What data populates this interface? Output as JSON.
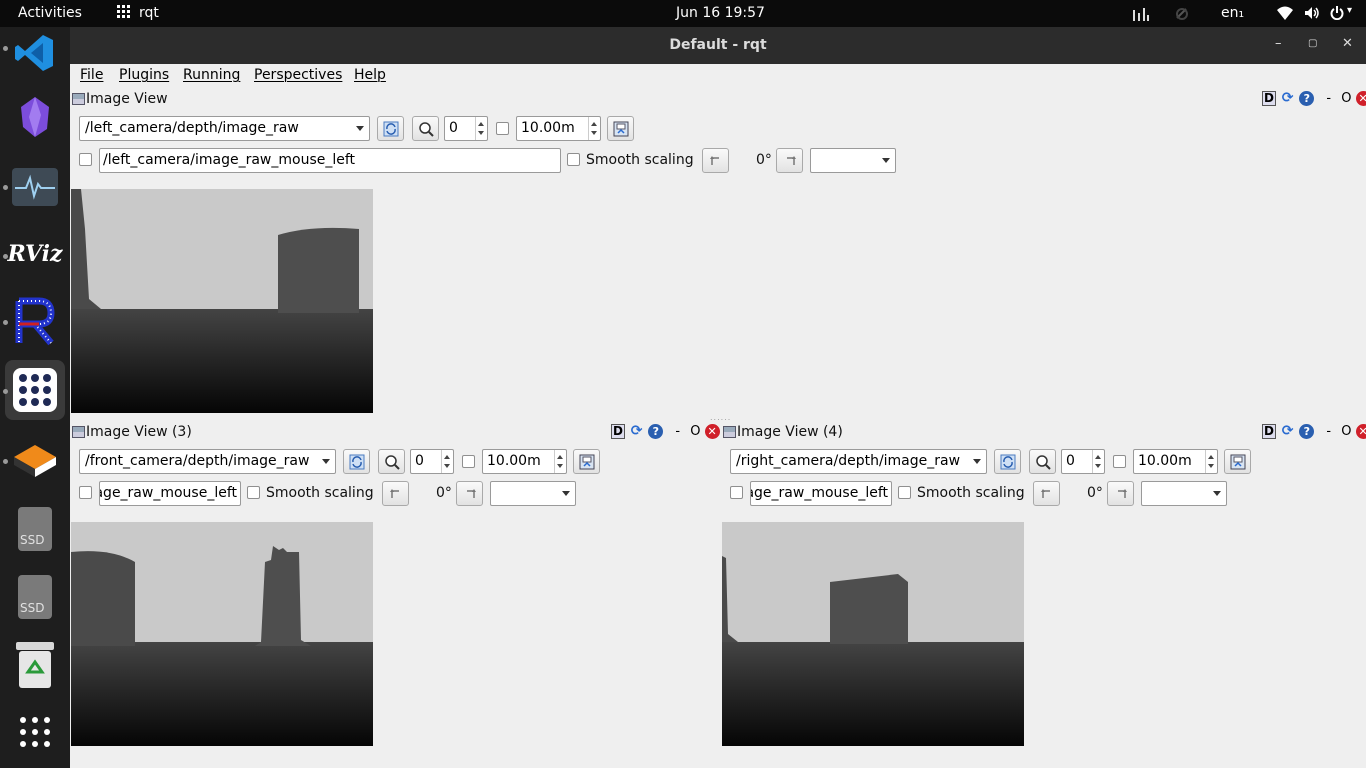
{
  "topbar": {
    "activities": "Activities",
    "app_name": "rqt",
    "datetime": "Jun 16  19:57",
    "lang": "en₁"
  },
  "window": {
    "title": "Default - rqt",
    "min": "–",
    "max": "▢",
    "close": "✕"
  },
  "menu": [
    "File",
    "Plugins",
    "Running",
    "Perspectives",
    "Help"
  ],
  "panels": {
    "p1": {
      "title": "Image View",
      "topic": "/left_camera/depth/image_raw",
      "min_value": "0",
      "max_value": "10.00m",
      "mouse_topic": "/left_camera/image_raw_mouse_left",
      "smooth": "Smooth scaling",
      "rotation": "0°"
    },
    "p3": {
      "title": "Image View (3)",
      "topic": "/front_camera/depth/image_raw",
      "min_value": "0",
      "max_value": "10.00m",
      "mouse_topic": "/front_camera/image_raw_mouse_left",
      "smooth": "Smooth scaling",
      "rotation": "0°"
    },
    "p4": {
      "title": "Image View (4)",
      "topic": "/right_camera/depth/image_raw",
      "min_value": "0",
      "max_value": "10.00m",
      "mouse_topic": "/right_camera/image_raw_mouse_left",
      "smooth": "Smooth scaling",
      "rotation": "0°"
    }
  },
  "panel_controls": {
    "d": "D",
    "help": "?",
    "dash": "-",
    "o": "O",
    "close": "✕"
  },
  "dock": {
    "rviz": "RViz",
    "ssd1": "SSD",
    "ssd2": "SSD"
  }
}
